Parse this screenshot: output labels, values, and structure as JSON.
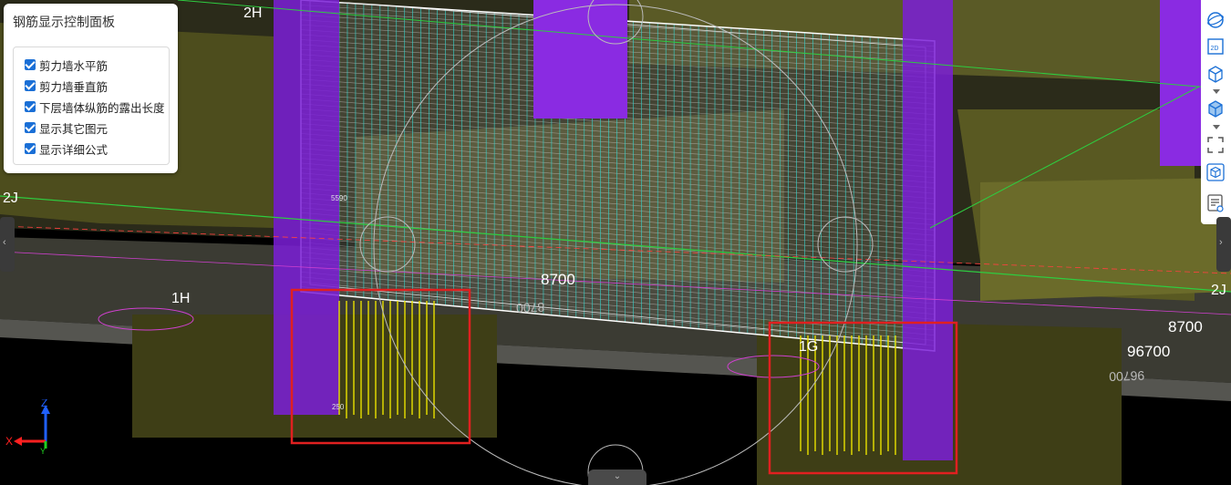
{
  "panel": {
    "title": "钢筋显示控制面板",
    "options": [
      {
        "label": "剪力墙水平筋",
        "checked": true
      },
      {
        "label": "剪力墙垂直筋",
        "checked": true
      },
      {
        "label": "下层墙体纵筋的露出长度",
        "checked": true
      },
      {
        "label": "显示其它图元",
        "checked": true
      },
      {
        "label": "显示详细公式",
        "checked": true
      }
    ]
  },
  "scene": {
    "axis_labels": {
      "2H": "2H",
      "2J_left": "2J",
      "2J_right": "2J",
      "1H": "1H",
      "1G": "1G"
    },
    "dimensions": {
      "center": "8700",
      "right": "8700",
      "right_lower": "96700",
      "mirror_center": "8700",
      "mirror_right": "96700"
    },
    "small_values": {
      "top_note": "5590",
      "bottom_note": "250"
    }
  },
  "axes": {
    "x": "X",
    "y": "Y",
    "z": "Z"
  },
  "colors": {
    "rebar_cyan": "#35d0c8",
    "rebar_yellow": "#e8e000",
    "column_purple": "#8a2be2",
    "highlight_red": "#e02020",
    "axis_green": "#2ecc40",
    "olive": "#5a5a20"
  }
}
